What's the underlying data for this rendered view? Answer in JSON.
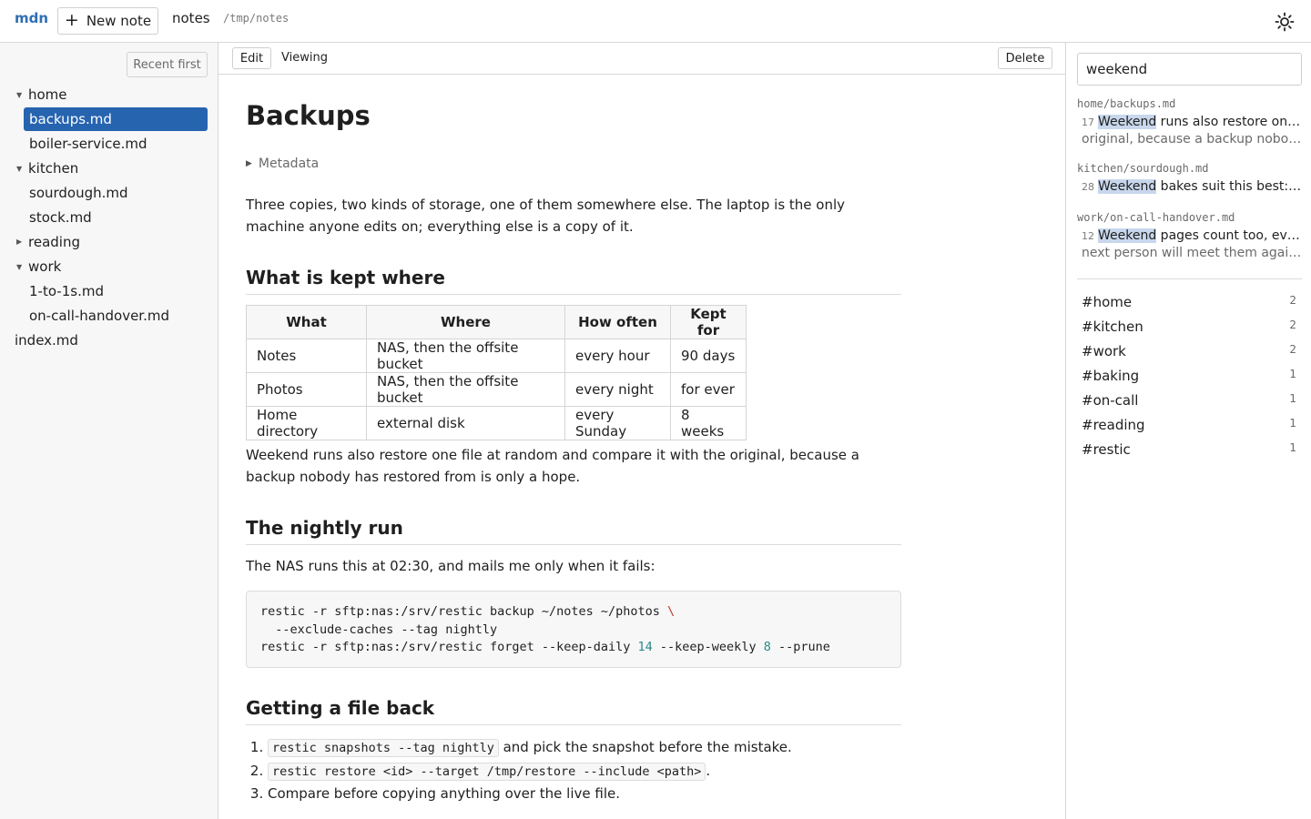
{
  "app": {
    "brand": "mdn",
    "new_note_label": "New note",
    "workspace_name": "notes",
    "workspace_path": "/tmp/notes"
  },
  "sidebar": {
    "sort_label": "Recent first",
    "tree": [
      {
        "label": "home",
        "type": "folder",
        "expanded": true
      },
      {
        "label": "backups.md",
        "type": "file",
        "selected": true
      },
      {
        "label": "boiler-service.md",
        "type": "file"
      },
      {
        "label": "kitchen",
        "type": "folder",
        "expanded": true
      },
      {
        "label": "sourdough.md",
        "type": "file"
      },
      {
        "label": "stock.md",
        "type": "file"
      },
      {
        "label": "reading",
        "type": "folder",
        "expanded": false
      },
      {
        "label": "work",
        "type": "folder",
        "expanded": true
      },
      {
        "label": "1-to-1s.md",
        "type": "file"
      },
      {
        "label": "on-call-handover.md",
        "type": "file"
      },
      {
        "label": "index.md",
        "type": "file"
      }
    ]
  },
  "toolbar": {
    "edit_label": "Edit",
    "mode_label": "Viewing",
    "delete_label": "Delete"
  },
  "document": {
    "title": "Backups",
    "metadata_label": "Metadata",
    "intro": "Three copies, two kinds of storage, one of them somewhere else. The laptop is the only machine anyone edits on; everything else is a copy of it.",
    "section1_heading": "What is kept where",
    "table": {
      "headers": [
        "What",
        "Where",
        "How often",
        "Kept for"
      ],
      "rows": [
        [
          "Notes",
          "NAS, then the offsite bucket",
          "every hour",
          "90 days"
        ],
        [
          "Photos",
          "NAS, then the offsite bucket",
          "every night",
          "for ever"
        ],
        [
          "Home directory",
          "external disk",
          "every Sunday",
          "8 weeks"
        ]
      ]
    },
    "weekend_para": "Weekend runs also restore one file at random and compare it with the original, because a backup nobody has restored from is only a hope.",
    "section2_heading": "The nightly run",
    "nightly_para": "The NAS runs this at 02:30, and mails me only when it fails:",
    "code": {
      "line1": "restic -r sftp:nas:/srv/restic backup ~/notes ~/photos",
      "line1_cont": "\\",
      "line2": "  --exclude-caches --tag nightly",
      "line3_a": "restic -r sftp:nas:/srv/restic forget --keep-daily ",
      "line3_n1": "14",
      "line3_b": " --keep-weekly ",
      "line3_n2": "8",
      "line3_c": " --prune"
    },
    "section3_heading": "Getting a file back",
    "steps": {
      "s1_code": "restic snapshots --tag nightly",
      "s1_text": " and pick the snapshot before the mistake.",
      "s2_code": "restic restore <id> --target /tmp/restore --include <path>",
      "s2_text": ".",
      "s3_text": "Compare before copying anything over the live file."
    }
  },
  "search": {
    "query": "weekend",
    "results": [
      {
        "path": "home/backups.md",
        "line": "17",
        "hit": "Weekend",
        "rest": " runs also restore one file at random and compare it with the",
        "line2": "original, because a backup nobody has restored from is only a hope."
      },
      {
        "path": "kitchen/sourdough.md",
        "line": "28",
        "hit": "Weekend",
        "rest": " bakes suit this best: mix on Friday night",
        "line2": ""
      },
      {
        "path": "work/on-call-handover.md",
        "line": "12",
        "hit": "Weekend",
        "rest": " pages count too, even when nothing breaks, because the",
        "line2": "next person will meet them again on Monday."
      }
    ]
  },
  "tags": [
    {
      "name": "#home",
      "count": "2"
    },
    {
      "name": "#kitchen",
      "count": "2"
    },
    {
      "name": "#work",
      "count": "2"
    },
    {
      "name": "#baking",
      "count": "1"
    },
    {
      "name": "#on-call",
      "count": "1"
    },
    {
      "name": "#reading",
      "count": "1"
    },
    {
      "name": "#restic",
      "count": "1"
    }
  ],
  "icons": {
    "new_note": "plus-icon",
    "theme": "sun-icon",
    "folder_open": "caret-down-icon",
    "folder_closed": "caret-right-icon"
  },
  "colors": {
    "accent": "#2664b0",
    "brand": "#2f6fb3",
    "highlight": "#c8d7ec"
  }
}
